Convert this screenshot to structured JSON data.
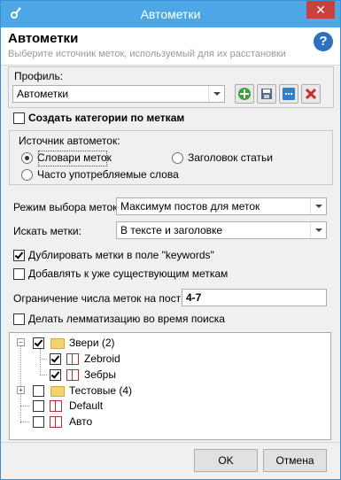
{
  "window": {
    "title": "Автометки"
  },
  "header": {
    "title": "Автометки",
    "subtitle": "Выберите источник меток, используемый для их расстановки"
  },
  "profile": {
    "label": "Профиль:",
    "value": "Автометки"
  },
  "options": {
    "create_categories": "Создать категории по меткам",
    "create_categories_checked": false
  },
  "source": {
    "label": "Источник автометок:",
    "radios": [
      {
        "label": "Словари меток",
        "checked": true
      },
      {
        "label": "Заголовок статьи",
        "checked": false
      },
      {
        "label": "Часто употребляемые слова",
        "checked": false
      }
    ]
  },
  "settings": {
    "mode_label": "Режим выбора меток:",
    "mode_value": "Максимум постов для меток",
    "search_label": "Искать метки:",
    "search_value": "В тексте и заголовке",
    "duplicate_label": "Дублировать метки в поле \"keywords\"",
    "duplicate_checked": true,
    "append_label": "Добавлять к уже существующим меткам",
    "append_checked": false,
    "limit_label": "Ограничение числа меток на пост:",
    "limit_value": "4-7",
    "lemma_label": "Делать лемматизацию во время поиска",
    "lemma_checked": false
  },
  "tree": {
    "items": [
      {
        "label": "Звери (2)",
        "checked": true,
        "type": "folder"
      },
      {
        "label": "Zebroid",
        "checked": true,
        "type": "book"
      },
      {
        "label": "Зебры",
        "checked": true,
        "type": "book"
      },
      {
        "label": "Тестовые (4)",
        "checked": false,
        "type": "folder"
      },
      {
        "label": "Default",
        "checked": false,
        "type": "book"
      },
      {
        "label": "Авто",
        "checked": false,
        "type": "book"
      }
    ]
  },
  "buttons": {
    "ok": "OK",
    "cancel": "Отмена"
  },
  "icons": [
    "app-icon",
    "close-icon",
    "help-icon",
    "add-icon",
    "save-icon",
    "rename-icon",
    "delete-icon",
    "folder-icon",
    "book-icon"
  ]
}
